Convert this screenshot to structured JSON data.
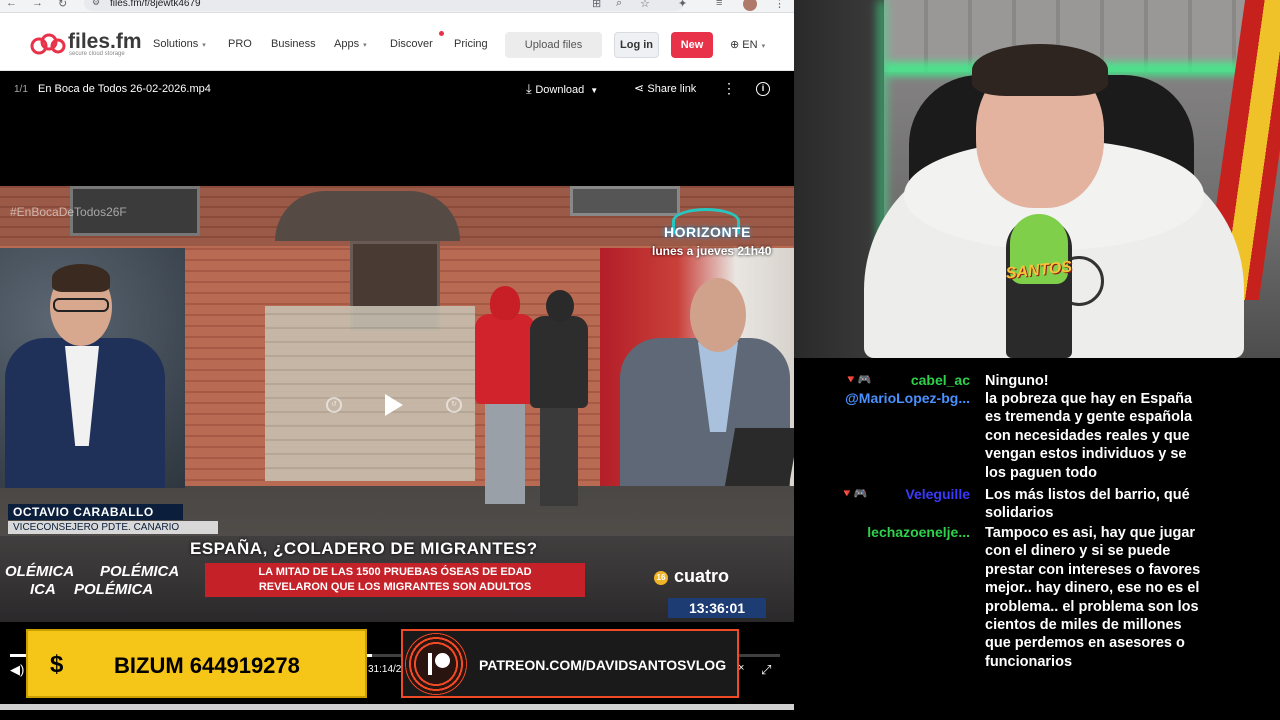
{
  "browser": {
    "url": "files.fm/f/8jewtk4679",
    "nav_back": "←",
    "nav_forward": "→",
    "nav_reload": "↻"
  },
  "site": {
    "logo": "files.fm",
    "logo_tagline": "secure cloud storage",
    "nav": [
      "Solutions",
      "PRO",
      "Business",
      "Apps",
      "Discover",
      "Pricing"
    ],
    "upload_label": "Upload files",
    "login_label": "Log in",
    "new_label": "New",
    "language": "EN",
    "accent_color": "#e8324a"
  },
  "file_bar": {
    "counter": "1/1",
    "file_name": "En Boca de Todos 26-02-2026.mp4",
    "download_label": "Download",
    "share_label": "Share link"
  },
  "video": {
    "hashtag": "#EnBocaDeTodos26F",
    "show_logo": "HORIZONTE",
    "show_schedule": "lunes a jueves 21h40",
    "guest_name": "OCTAVIO CARABALLO",
    "guest_role": "VICECONSEJERO PDTE. CANARIO",
    "headline": "ESPAÑA, ¿COLADERO DE MIGRANTES?",
    "subheadline_1": "LA MITAD DE LAS 1500 PRUEBAS ÓSEAS DE EDAD",
    "subheadline_2": "REVELARON QUE LOS MIGRANTES SON ADULTOS",
    "polemica": [
      "OLÉMICA",
      "POLÉMICA",
      "ICA",
      "POLÉMICA"
    ],
    "age_rating": "16",
    "channel": "cuatro",
    "clock": "13:36:01"
  },
  "player": {
    "time": "31:14/2",
    "progress": 0.47
  },
  "overlays": {
    "bizum_icon": "$",
    "bizum": "BIZUM 644919278",
    "patreon": "PATREON.COM/DAVIDSANTOSVLOG"
  },
  "webcam": {
    "mic_brand": "SANTOS"
  },
  "chat": [
    {
      "user": "cabel_ac",
      "color": "#2fd14b",
      "badges": "🔻🎮",
      "lines": [
        "Ninguno!"
      ]
    },
    {
      "user": "@MarioLopez-bg...",
      "color": "#4a90ff",
      "badges": "",
      "lines": [
        "la pobreza que hay en España",
        "es tremenda y gente española",
        "con necesidades reales y que",
        "vengan estos individuos y se",
        "los paguen todo"
      ]
    },
    {
      "user": "Veleguille",
      "color": "#3a3aff",
      "badges": "🔻🎮",
      "lines": [
        "Los más listos del barrio, qué",
        "solidarios"
      ]
    },
    {
      "user": "lechazoenelje...",
      "color": "#2fd14b",
      "badges": "🎟",
      "lines": [
        "Tampoco es asi, hay que jugar",
        "con el dinero y si se puede",
        "prestar con intereses o favores",
        "mejor.. hay dinero, ese no es el",
        "problema.. el problema son los",
        "cientos de miles de millones",
        "que perdemos en asesores o",
        "funcionarios"
      ]
    }
  ]
}
